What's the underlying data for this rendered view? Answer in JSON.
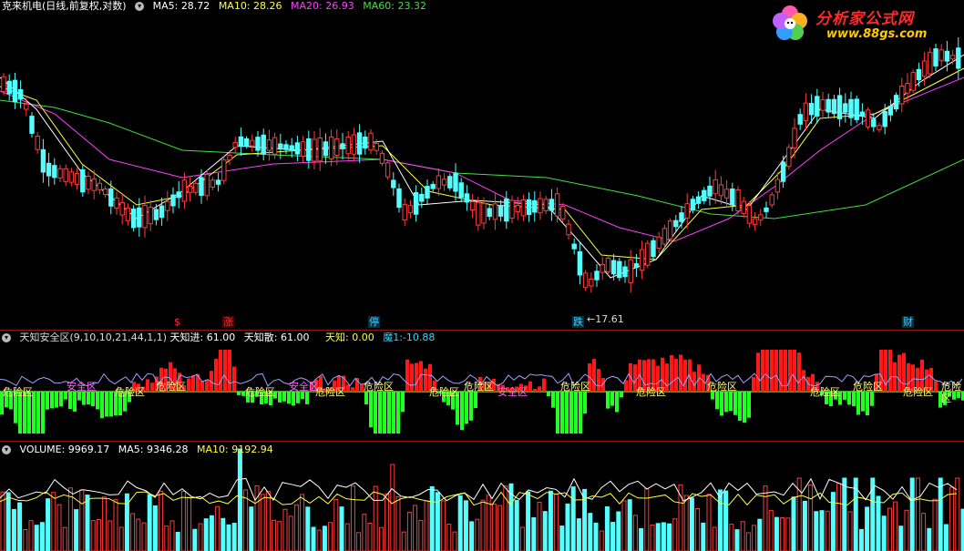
{
  "main": {
    "stock": "克来机电",
    "mode": "(日线,前复权,对数)",
    "ma5_label": "MA5:",
    "ma5": "28.72",
    "ma10_label": "MA10:",
    "ma10": "28.26",
    "ma20_label": "MA20:",
    "ma20": "26.93",
    "ma60_label": "MA60:",
    "ma60": "23.32",
    "low_label": "17.61",
    "signals": [
      {
        "text": "$",
        "color": "#ff3030"
      },
      {
        "text": "涨",
        "color": "#ff3030"
      },
      {
        "text": "停",
        "color": "#40d0ff"
      },
      {
        "text": "跌",
        "color": "#40d0ff"
      },
      {
        "text": "财",
        "color": "#40d0ff"
      }
    ]
  },
  "logo": {
    "title": "分析家公式网",
    "url": "www.88gs.com"
  },
  "indicator": {
    "name": "天知安全区",
    "params": "(9,10,10,21,44,1,1)",
    "in_label": "天知进:",
    "in_value": "61.00",
    "out_label": "天知散:",
    "out_value": "61.00",
    "tz_label": "天知:",
    "tz_value": "0.00",
    "mo_label": "魔1:",
    "mo_value": "-10.88",
    "zone_labels": [
      "危险区",
      "安全区",
      "危险区",
      "危险区",
      "危险区",
      "安全区",
      "危险区",
      "危险区",
      "危险区",
      "危险区",
      "安全区",
      "危险区",
      "危险区",
      "危险区",
      "危险区",
      "危险区",
      "危险区",
      "危险区"
    ]
  },
  "volume": {
    "label": "VOLUME:",
    "value": "9969.17",
    "ma5_label": "MA5:",
    "ma5": "9346.28",
    "ma10_label": "MA10:",
    "ma10": "9192.94"
  },
  "colors": {
    "up": "#ff3b3b",
    "down": "#54ffff",
    "ma5": "#ffffff",
    "ma10": "#ffff40",
    "ma20": "#ff40ff",
    "ma60": "#40e040",
    "good": "#ff1818",
    "bad": "#22ff22"
  }
}
